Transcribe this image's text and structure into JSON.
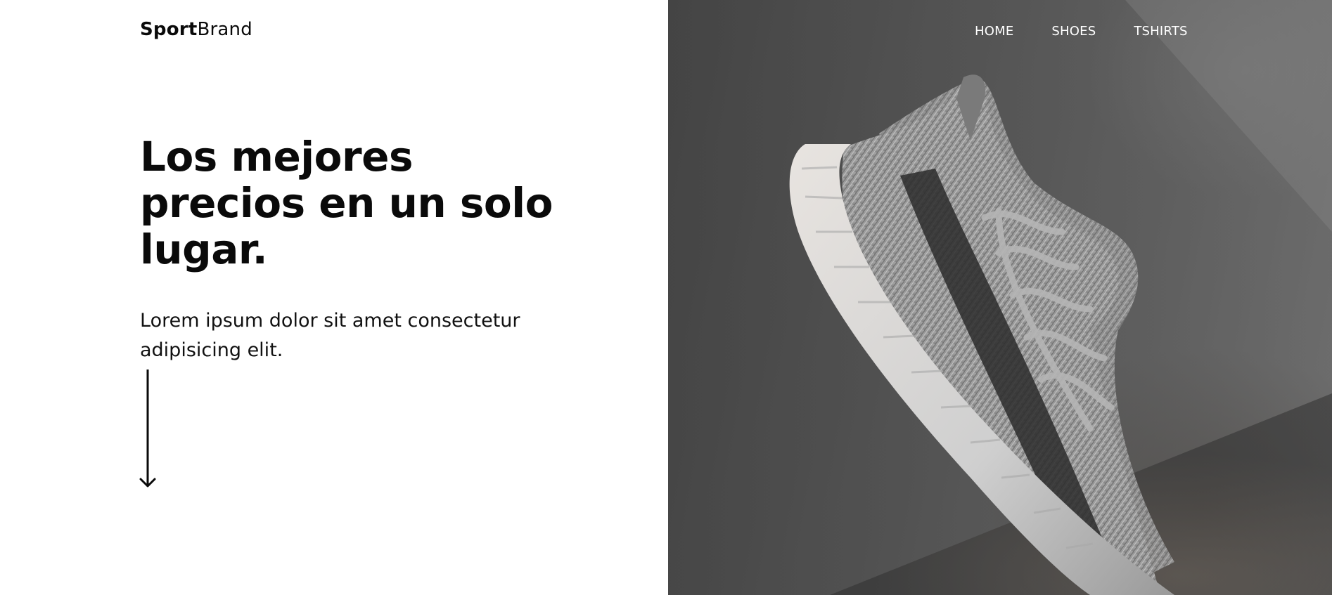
{
  "brand": {
    "bold": "Sport",
    "light": "Brand"
  },
  "hero": {
    "headline_lines": [
      "Los mejores",
      "precios en un solo",
      "lugar."
    ],
    "subtext": "Lorem ipsum dolor sit amet consectetur adipisicing elit.",
    "image_subject": "grey knit sneakers leaning on a dark concrete wall"
  },
  "nav": {
    "items": [
      {
        "label": "HOME"
      },
      {
        "label": "SHOES"
      },
      {
        "label": "TSHIRTS"
      }
    ]
  },
  "icons": {
    "scroll": "arrow-down-icon"
  },
  "colors": {
    "text": "#0a0a0a",
    "background": "#ffffff",
    "nav_text": "#ffffff",
    "hero_tone": "#5a5a5a"
  }
}
